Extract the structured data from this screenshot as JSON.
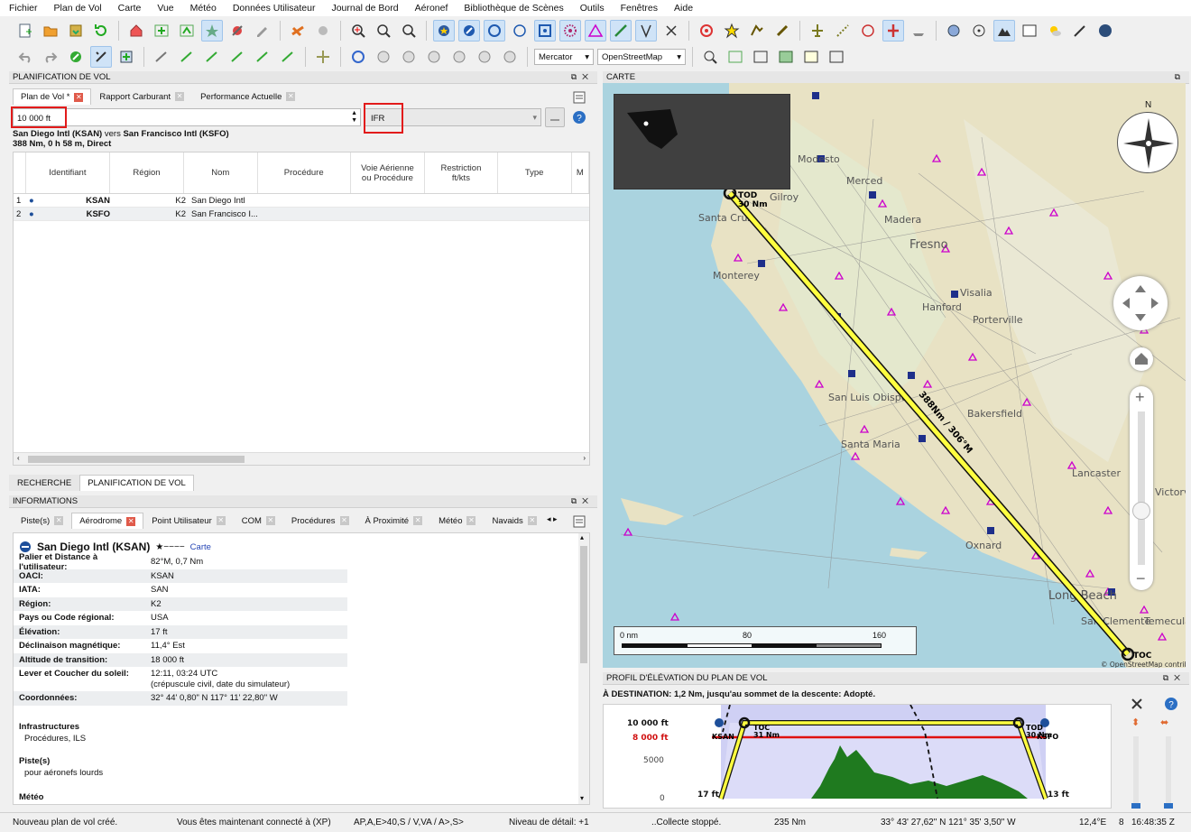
{
  "menu": [
    "Fichier",
    "Plan de Vol",
    "Carte",
    "Vue",
    "Météo",
    "Données Utilisateur",
    "Journal de Bord",
    "Aéronef",
    "Bibliothèque de Scènes",
    "Outils",
    "Fenêtres",
    "Aide"
  ],
  "toolbar2": {
    "projection": "Mercator",
    "theme": "OpenStreetMap"
  },
  "planning_panel": {
    "title": "PLANIFICATION DE VOL",
    "tabs": [
      "Plan de Vol *",
      "Rapport Carburant",
      "Performance Actuelle"
    ],
    "altitude_value": "10 000 ft",
    "flight_rules": "IFR",
    "route_from": "San Diego Intl (KSAN)",
    "route_mid": " vers ",
    "route_to": "San Francisco Intl (KSFO)",
    "route_summary": "388 Nm, 0 h 58 m, Direct",
    "columns": [
      "Identifiant",
      "Région",
      "Nom",
      "Procédure",
      "Voie Aérienne ou Procédure",
      "Restriction ft/kts",
      "Type",
      "M"
    ],
    "rows": [
      {
        "num": "1",
        "ident": "KSAN",
        "region": "K2",
        "name": "San Diego Intl"
      },
      {
        "num": "2",
        "ident": "KSFO",
        "region": "K2",
        "name": "San Francisco I..."
      }
    ]
  },
  "bottom_tabs": [
    "RECHERCHE",
    "PLANIFICATION DE VOL"
  ],
  "info_panel": {
    "title": "INFORMATIONS",
    "tabs": [
      "Piste(s)",
      "Aérodrome",
      "Point Utilisateur",
      "COM",
      "Procédures",
      "À Proximité",
      "Météo",
      "Navaids"
    ],
    "airport_title": "San Diego Intl (KSAN)",
    "airport_rating": "★−−−−",
    "map_link": "Carte",
    "fields": [
      {
        "k": "Palier et Distance à l'utilisateur:",
        "v": "82°M, 0,7 Nm"
      },
      {
        "k": "OACI:",
        "v": "KSAN"
      },
      {
        "k": "IATA:",
        "v": "SAN"
      },
      {
        "k": "Région:",
        "v": "K2"
      },
      {
        "k": "Pays ou Code régional:",
        "v": "USA"
      },
      {
        "k": "Élévation:",
        "v": "17 ft"
      },
      {
        "k": "Déclinaison magnétique:",
        "v": "11,4° Est"
      },
      {
        "k": "Altitude de transition:",
        "v": "18 000 ft"
      },
      {
        "k": "Lever et Coucher du soleil:",
        "v": "12:11, 03:24 UTC"
      },
      {
        "k": "",
        "v": "(crépuscule civil, date du simulateur)"
      },
      {
        "k": "Coordonnées:",
        "v": "32° 44' 0,80\" N 117° 11' 22,80\" W"
      }
    ],
    "infra_head": "Infrastructures",
    "infra_value": "Procédures, ILS",
    "runways_head": "Piste(s)",
    "runways_value": "pour aéronefs lourds",
    "weather_head": "Météo"
  },
  "map_panel": {
    "title": "CARTE",
    "cities": [
      "Modesto",
      "Merced",
      "Madera",
      "Fresno",
      "Santa Cruz",
      "Gilroy",
      "Monterey",
      "Visalia",
      "Hanford",
      "Porterville",
      "San Luis Obispo",
      "Bakersfield",
      "Santa Maria",
      "Lancaster",
      "Oxnard",
      "Long Beach",
      "San Clemente",
      "Temecula",
      "Victorville"
    ],
    "route_label": "388Nm / 306°M",
    "tod_label": "TOD",
    "tod_dist": "30 Nm",
    "toc_label": "TOC",
    "scale_labels": [
      "0 nm",
      "80",
      "160"
    ],
    "attribution": "© OpenStreetMap contributors",
    "compass_n": "N"
  },
  "profile_panel": {
    "title": "PROFIL D'ÉLÉVATION DU PLAN DE VOL",
    "status_text": "À DESTINATION: 1,2 Nm, jusqu'au sommet de la descente: Adopté.",
    "cruise_alt": "10 000 ft",
    "safe_alt": "8 000 ft",
    "mid_tick": "5000",
    "zero_tick": "0",
    "dep_elev": "17 ft",
    "arr_elev": "13 ft",
    "dep_ident": "KSAN",
    "arr_ident": "KSFO",
    "toc_label": "TOC",
    "toc_dist": "31 Nm",
    "tod_label": "TOD",
    "tod_dist": "30 Nm"
  },
  "statusbar": {
    "msg": "Nouveau plan de vol créé.",
    "connection": "Vous êtes maintenant connecté à (XP)",
    "codes": "AP,A,E>40,S / V,VA / A>,S>",
    "detail": "Niveau de détail: +1",
    "collect": "..Collecte stoppé.",
    "distance": "235 Nm",
    "coords": "33° 43' 27,62\" N 121° 35' 3,50\" W",
    "magvar": "12,4°E",
    "zoom": "8",
    "time": "16:48:35 Z"
  }
}
